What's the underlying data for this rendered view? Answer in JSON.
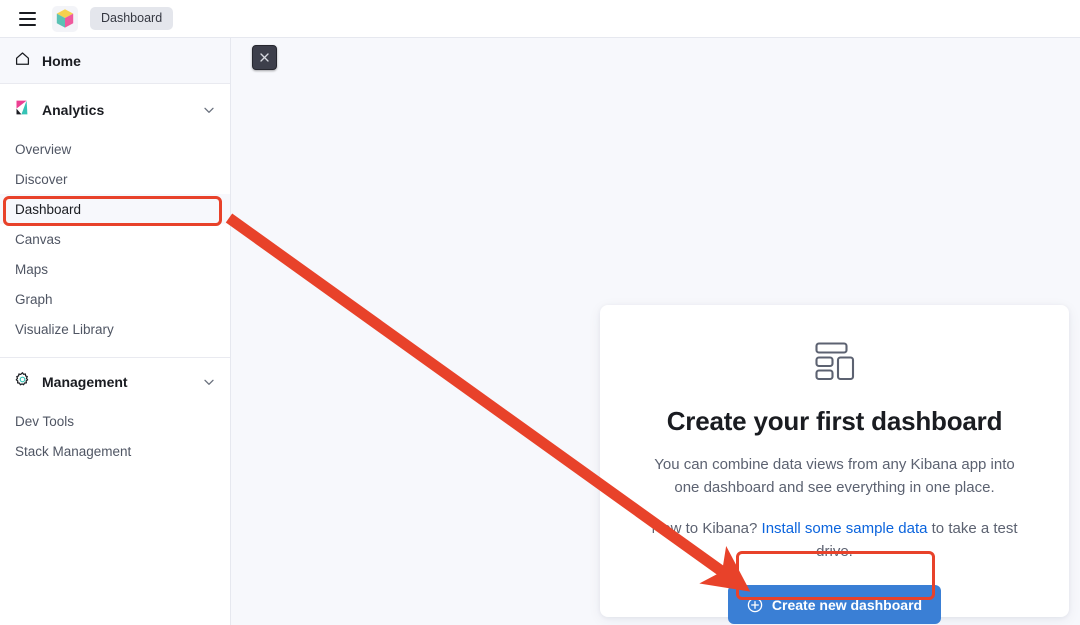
{
  "header": {
    "menu_icon": "hamburger-menu-icon",
    "logo_icon": "elastic-cube-logo-icon",
    "breadcrumb": "Dashboard"
  },
  "overlay": {
    "close_label": "×",
    "close_icon": "close-x-icon",
    "annotation_color": "#e8422a"
  },
  "sidebar": {
    "home": {
      "label": "Home",
      "icon": "home-icon"
    },
    "groups": [
      {
        "label": "Analytics",
        "icon": "kibana-k-logo-icon",
        "expand_icon": "chevron-down-icon",
        "items": [
          {
            "label": "Overview",
            "active": false
          },
          {
            "label": "Discover",
            "active": false
          },
          {
            "label": "Dashboard",
            "active": true
          },
          {
            "label": "Canvas",
            "active": false
          },
          {
            "label": "Maps",
            "active": false
          },
          {
            "label": "Graph",
            "active": false
          },
          {
            "label": "Visualize Library",
            "active": false
          }
        ]
      },
      {
        "label": "Management",
        "icon": "gear-icon",
        "expand_icon": "chevron-down-icon",
        "items": [
          {
            "label": "Dev Tools",
            "active": false
          },
          {
            "label": "Stack Management",
            "active": false
          }
        ]
      }
    ]
  },
  "main": {
    "empty_state": {
      "icon": "dashboard-layout-icon",
      "title": "Create your first dashboard",
      "description": "You can combine data views from any Kibana app into one dashboard and see everything in one place.",
      "prompt_prefix": "New to Kibana? ",
      "prompt_link": "Install some sample data",
      "prompt_suffix": " to take a test drive.",
      "button_label": "Create new dashboard",
      "button_icon": "plus-circle-icon",
      "button_color": "#3a7fd5",
      "link_color": "#0b64dd"
    }
  }
}
